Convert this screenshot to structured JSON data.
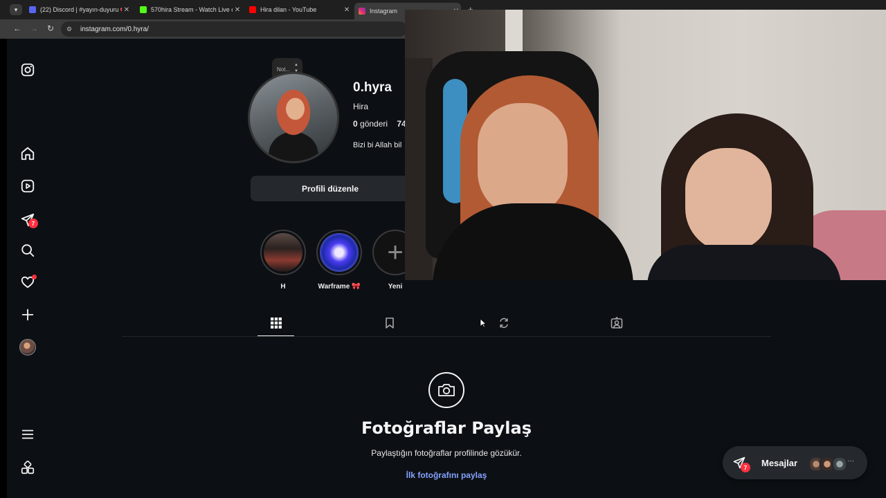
{
  "browser": {
    "tabs": [
      {
        "title": "(22) Discord | #yayın-duyuru 📢",
        "active": false,
        "favicon_color": "#5865f2"
      },
      {
        "title": "570hira Stream - Watch Live on",
        "active": false,
        "favicon_color": "#53fc18"
      },
      {
        "title": "Hira dilan - YouTube",
        "active": false,
        "favicon_color": "#ff0000"
      },
      {
        "title": "Instagram",
        "active": true,
        "favicon_color": "#e1306c"
      }
    ],
    "new_tab_label": "+",
    "url": "instagram.com/0.hyra/",
    "close_glyph": "✕"
  },
  "sidebar": {
    "items": [
      {
        "name": "instagram-logo-icon"
      },
      {
        "name": "home-icon"
      },
      {
        "name": "reels-icon"
      },
      {
        "name": "messages-icon",
        "badge": "7"
      },
      {
        "name": "search-icon"
      },
      {
        "name": "notifications-heart-icon",
        "dot": true
      },
      {
        "name": "create-plus-icon"
      },
      {
        "name": "profile-avatar"
      },
      {
        "name": "more-menu-icon"
      },
      {
        "name": "threads-apps-icon"
      }
    ]
  },
  "profile": {
    "note": "Not...",
    "username": "0.hyra",
    "full_name": "Hira",
    "posts_count": "0",
    "posts_label": "gönderi",
    "followers_partial": "74",
    "bio": "Bizi bi Allah bil",
    "edit_button": "Profili düzenle"
  },
  "highlights": [
    {
      "label": "H"
    },
    {
      "label": "Warframe 🎀"
    },
    {
      "label": "Yeni"
    }
  ],
  "profile_tabs": [
    {
      "name": "posts-grid-icon",
      "active": true
    },
    {
      "name": "saved-bookmark-icon",
      "active": false
    },
    {
      "name": "reposts-icon",
      "active": false
    },
    {
      "name": "tagged-icon",
      "active": false
    }
  ],
  "empty_state": {
    "title": "Fotoğraflar Paylaş",
    "subtitle": "Paylaştığın fotoğraflar profilinde gözükür.",
    "link": "İlk fotoğrafını paylaş"
  },
  "messages_pill": {
    "label": "Mesajlar",
    "badge": "7",
    "more": "···"
  },
  "colors": {
    "background": "#0c1014",
    "badge": "#ff3040",
    "link": "#85a1ff",
    "button": "#25292e"
  }
}
